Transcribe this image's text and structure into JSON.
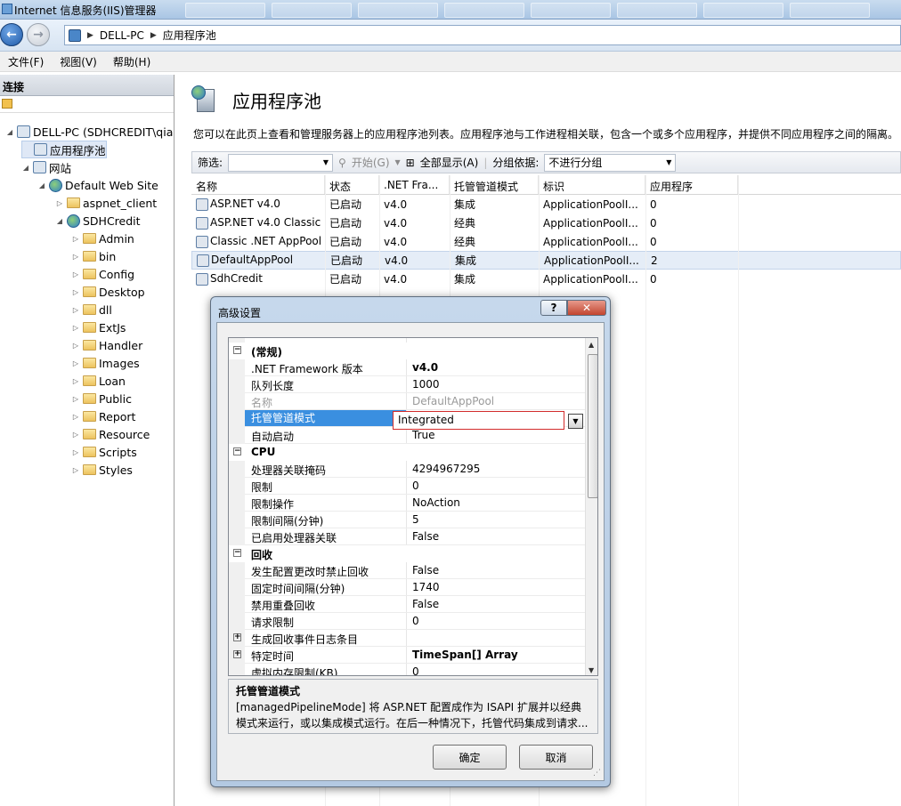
{
  "window": {
    "title": "Internet 信息服务(IIS)管理器"
  },
  "address": {
    "segments": [
      "DELL-PC",
      "应用程序池"
    ]
  },
  "menu": [
    {
      "label": "文件(F)"
    },
    {
      "label": "视图(V)"
    },
    {
      "label": "帮助(H)"
    }
  ],
  "left": {
    "header": "连接",
    "tree": [
      {
        "label": "DELL-PC (SDHCREDIT\\qian",
        "icon": "server-icon",
        "expander": "◢"
      },
      {
        "label": "应用程序池",
        "icon": "app-pool-icon",
        "expander": "",
        "selected": true
      },
      {
        "label": "网站",
        "icon": "sites-icon",
        "expander": "◢"
      },
      {
        "label": "Default Web Site",
        "icon": "globe-icon",
        "expander": "◢"
      },
      {
        "label": "aspnet_client",
        "icon": "folder-icon",
        "expander": "▷"
      },
      {
        "label": "SDHCredit",
        "icon": "app-icon",
        "expander": "◢"
      },
      {
        "label": "Admin",
        "icon": "folder-icon",
        "expander": "▷"
      },
      {
        "label": "bin",
        "icon": "folder-icon",
        "expander": "▷"
      },
      {
        "label": "Config",
        "icon": "folder-icon",
        "expander": "▷"
      },
      {
        "label": "Desktop",
        "icon": "folder-icon",
        "expander": "▷"
      },
      {
        "label": "dll",
        "icon": "folder-icon",
        "expander": "▷"
      },
      {
        "label": "ExtJs",
        "icon": "folder-icon",
        "expander": "▷"
      },
      {
        "label": "Handler",
        "icon": "folder-icon",
        "expander": "▷"
      },
      {
        "label": "Images",
        "icon": "folder-icon",
        "expander": "▷"
      },
      {
        "label": "Loan",
        "icon": "folder-icon",
        "expander": "▷"
      },
      {
        "label": "Public",
        "icon": "folder-icon",
        "expander": "▷"
      },
      {
        "label": "Report",
        "icon": "folder-icon",
        "expander": "▷"
      },
      {
        "label": "Resource",
        "icon": "folder-icon",
        "expander": "▷"
      },
      {
        "label": "Scripts",
        "icon": "folder-icon",
        "expander": "▷"
      },
      {
        "label": "Styles",
        "icon": "folder-icon",
        "expander": "▷"
      }
    ]
  },
  "main": {
    "title": "应用程序池",
    "description": "您可以在此页上查看和管理服务器上的应用程序池列表。应用程序池与工作进程相关联，包含一个或多个应用程序，并提供不同应用程序之间的隔离。",
    "filter": {
      "label": "筛选:",
      "start": "开始(G)",
      "show_all": "全部显示(A)",
      "group_label": "分组依据:",
      "group_value": "不进行分组"
    },
    "columns": [
      "名称",
      "状态",
      ".NET Fra...",
      "托管管道模式",
      "标识",
      "应用程序"
    ],
    "rows": [
      [
        "ASP.NET v4.0",
        "已启动",
        "v4.0",
        "集成",
        "ApplicationPoolI...",
        "0"
      ],
      [
        "ASP.NET v4.0 Classic",
        "已启动",
        "v4.0",
        "经典",
        "ApplicationPoolI...",
        "0"
      ],
      [
        "Classic .NET AppPool",
        "已启动",
        "v4.0",
        "经典",
        "ApplicationPoolI...",
        "0"
      ],
      [
        "DefaultAppPool",
        "已启动",
        "v4.0",
        "集成",
        "ApplicationPoolI...",
        "2"
      ],
      [
        "SdhCredit",
        "已启动",
        "v4.0",
        "集成",
        "ApplicationPoolI...",
        "0"
      ]
    ]
  },
  "dialog": {
    "title": "高级设置",
    "help": "?",
    "close": "✕",
    "properties": [
      {
        "cat": true,
        "box": "⊟",
        "k": "(常规)"
      },
      {
        "k": ".NET Framework 版本",
        "v": "v4.0",
        "bold": true
      },
      {
        "k": "队列长度",
        "v": "1000"
      },
      {
        "k": "名称",
        "v": "DefaultAppPool",
        "disabled": true
      },
      {
        "k": "托管管道模式",
        "v": "Integrated",
        "selected": true
      },
      {
        "k": "自动启动",
        "v": "True"
      },
      {
        "cat": true,
        "box": "⊟",
        "k": "CPU"
      },
      {
        "k": "处理器关联掩码",
        "v": "4294967295"
      },
      {
        "k": "限制",
        "v": "0"
      },
      {
        "k": "限制操作",
        "v": "NoAction"
      },
      {
        "k": "限制间隔(分钟)",
        "v": "5"
      },
      {
        "k": "已启用处理器关联",
        "v": "False"
      },
      {
        "cat": true,
        "box": "⊟",
        "k": "回收"
      },
      {
        "k": "发生配置更改时禁止回收",
        "v": "False"
      },
      {
        "k": "固定时间间隔(分钟)",
        "v": "1740"
      },
      {
        "k": "禁用重叠回收",
        "v": "False"
      },
      {
        "k": "请求限制",
        "v": "0"
      },
      {
        "k": "生成回收事件日志条目",
        "v": "",
        "box": "⊞"
      },
      {
        "k": "特定时间",
        "v": "TimeSpan[] Array",
        "bold": true,
        "box": "⊞"
      },
      {
        "k": "虚拟内存限制(KB)",
        "v": "0"
      }
    ],
    "desc_title": "托管管道模式",
    "desc_text": "[managedPipelineMode] 将 ASP.NET 配置成作为 ISAPI 扩展并以经典模式来运行，或以集成模式运行。在后一种情况下，托管代码集成到请求...",
    "ok": "确定",
    "cancel": "取消"
  },
  "colors": {
    "accent": "#3a8fe0",
    "highlight_border": "#d22b2b",
    "title_bg": "#b3c9e2"
  }
}
